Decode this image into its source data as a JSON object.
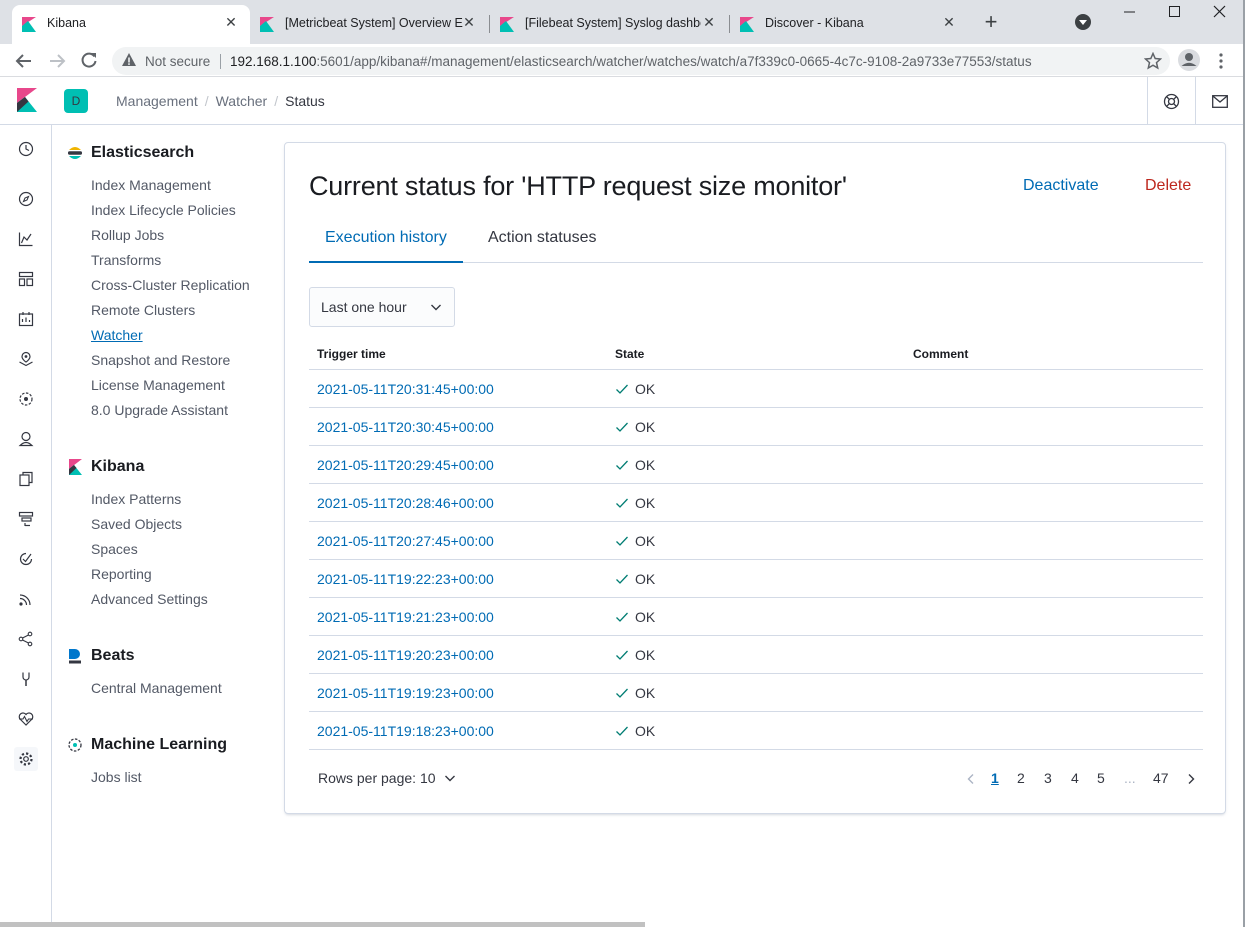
{
  "browser": {
    "tabs": [
      {
        "title": "Kibana",
        "active": true
      },
      {
        "title": "[Metricbeat System] Overview EC",
        "active": false
      },
      {
        "title": "[Filebeat System] Syslog dashboa",
        "active": false
      },
      {
        "title": "Discover - Kibana",
        "active": false
      }
    ],
    "security_label": "Not secure",
    "url_host": "192.168.1.100",
    "url_rest": ":5601/app/kibana#/management/elasticsearch/watcher/watches/watch/a7f339c0-0665-4c7c-9108-2a9733e77553/status"
  },
  "header": {
    "space_initial": "D",
    "breadcrumbs": [
      "Management",
      "Watcher",
      "Status"
    ]
  },
  "sidebar": {
    "sections": [
      {
        "title": "Elasticsearch",
        "items": [
          "Index Management",
          "Index Lifecycle Policies",
          "Rollup Jobs",
          "Transforms",
          "Cross-Cluster Replication",
          "Remote Clusters",
          "Watcher",
          "Snapshot and Restore",
          "License Management",
          "8.0 Upgrade Assistant"
        ]
      },
      {
        "title": "Kibana",
        "items": [
          "Index Patterns",
          "Saved Objects",
          "Spaces",
          "Reporting",
          "Advanced Settings"
        ]
      },
      {
        "title": "Beats",
        "items": [
          "Central Management"
        ]
      },
      {
        "title": "Machine Learning",
        "items": [
          "Jobs list"
        ]
      }
    ],
    "selected_item": "Watcher"
  },
  "main": {
    "title": "Current status for 'HTTP request size monitor'",
    "deactivate_label": "Deactivate",
    "delete_label": "Delete",
    "tabs": [
      "Execution history",
      "Action statuses"
    ],
    "time_range": "Last one hour",
    "columns": [
      "Trigger time",
      "State",
      "Comment"
    ],
    "rows": [
      {
        "trigger_time": "2021-05-11T20:31:45+00:00",
        "state": "OK",
        "comment": ""
      },
      {
        "trigger_time": "2021-05-11T20:30:45+00:00",
        "state": "OK",
        "comment": ""
      },
      {
        "trigger_time": "2021-05-11T20:29:45+00:00",
        "state": "OK",
        "comment": ""
      },
      {
        "trigger_time": "2021-05-11T20:28:46+00:00",
        "state": "OK",
        "comment": ""
      },
      {
        "trigger_time": "2021-05-11T20:27:45+00:00",
        "state": "OK",
        "comment": ""
      },
      {
        "trigger_time": "2021-05-11T19:22:23+00:00",
        "state": "OK",
        "comment": ""
      },
      {
        "trigger_time": "2021-05-11T19:21:23+00:00",
        "state": "OK",
        "comment": ""
      },
      {
        "trigger_time": "2021-05-11T19:20:23+00:00",
        "state": "OK",
        "comment": ""
      },
      {
        "trigger_time": "2021-05-11T19:19:23+00:00",
        "state": "OK",
        "comment": ""
      },
      {
        "trigger_time": "2021-05-11T19:18:23+00:00",
        "state": "OK",
        "comment": ""
      }
    ],
    "rows_per_page_label": "Rows per page: 10",
    "pagination": {
      "pages": [
        "1",
        "2",
        "3",
        "4",
        "5",
        "...",
        "47"
      ],
      "current": "1"
    }
  },
  "colors": {
    "link": "#006bb4",
    "danger": "#bd271e",
    "success": "#017d73",
    "space_badge": "#00bfb3"
  }
}
